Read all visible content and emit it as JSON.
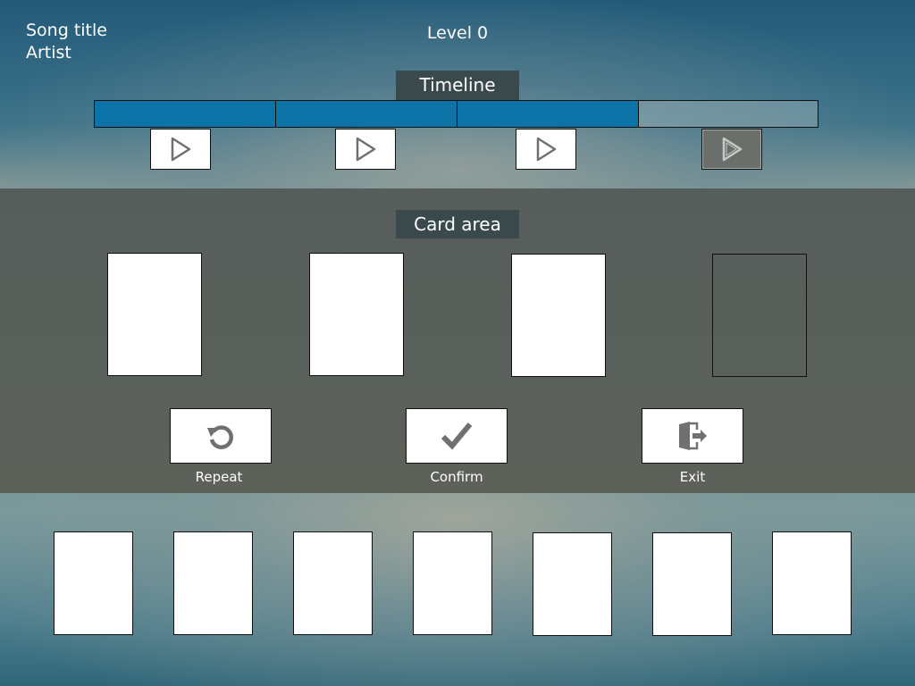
{
  "header": {
    "song_title": "Song title",
    "artist": "Artist",
    "level": "Level 0"
  },
  "timeline": {
    "label": "Timeline",
    "segments": [
      {
        "state": "filled"
      },
      {
        "state": "filled"
      },
      {
        "state": "filled"
      },
      {
        "state": "empty"
      }
    ],
    "play_buttons": [
      {
        "icon": "play-icon",
        "enabled": true
      },
      {
        "icon": "play-icon",
        "enabled": true
      },
      {
        "icon": "play-icon",
        "enabled": true
      },
      {
        "icon": "play-icon",
        "enabled": false
      }
    ]
  },
  "card_area": {
    "label": "Card area",
    "slots": [
      {
        "filled": true
      },
      {
        "filled": true
      },
      {
        "filled": true
      },
      {
        "filled": false
      }
    ]
  },
  "actions": {
    "repeat": {
      "label": "Repeat",
      "icon": "repeat-icon"
    },
    "confirm": {
      "label": "Confirm",
      "icon": "checkmark-icon"
    },
    "exit": {
      "label": "Exit",
      "icon": "exit-door-icon"
    }
  },
  "hand": {
    "card_count": 7
  },
  "colors": {
    "timeline_fill": "#0b73a6",
    "label_bg": "#3a4a4c",
    "card_band": "#5a605b",
    "icon_gray": "#707070"
  }
}
